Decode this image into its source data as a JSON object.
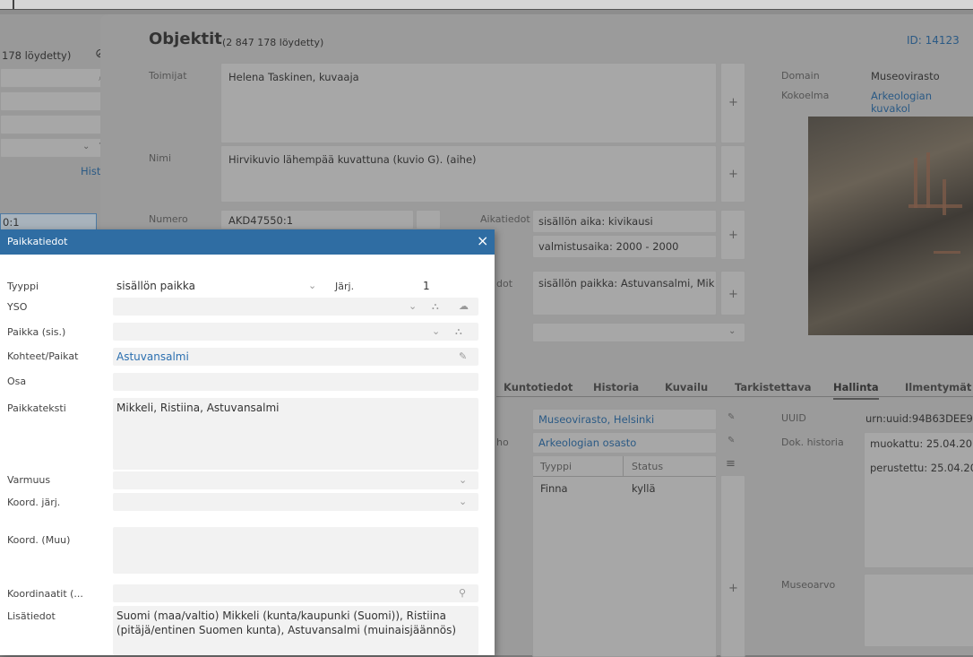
{
  "left_panel": {
    "count_text": "178 löydetty)",
    "history_link": "History",
    "selected_value": "0:1",
    "selected_sub": "Hirvikuvio lähempää"
  },
  "main": {
    "title": "Objektit",
    "count": "(2 847 178 löydetty)",
    "id_label": "ID: 14123",
    "fields": {
      "toimijat_label": "Toimijat",
      "toimijat_value": "Helena Taskinen, kuvaaja",
      "nimi_label": "Nimi",
      "nimi_value": "Hirvikuvio lähempää kuvattuna (kuvio G). (aihe)",
      "numero_label": "Numero",
      "numero_value": "AKD47550:1",
      "aikatiedot_label": "Aikatiedot",
      "aika_1": "sisällön aika: kivikausi",
      "aika_2": "valmistusaika: 2000 - 2000",
      "paikkatiedot_label_partial": "dot",
      "paikka_value": "sisällön paikka: Astuvansalmi, Mik"
    },
    "side": {
      "domain_label": "Domain",
      "domain_value": "Museovirasto",
      "kokoelma_label": "Kokoelma",
      "kokoelma_value": "Arkeologian kuvakol"
    },
    "tabs": [
      "Kuntotiedot",
      "Historia",
      "Kuvailu",
      "Tarkistettava",
      "Hallinta",
      "Ilmentymät"
    ],
    "hallinta": {
      "org_value": "Museovirasto, Helsinki",
      "unit_label_partial": "ho",
      "unit_value": "Arkeologian osasto",
      "table_headers": [
        "Tyyppi",
        "Status"
      ],
      "table_rows": [
        [
          "Finna",
          "kyllä"
        ]
      ],
      "uuid_label": "UUID",
      "uuid_value": "urn:uuid:94B63DEE9",
      "dok_label": "Dok. historia",
      "dok_1": "muokattu: 25.04.20",
      "dok_2": "perustettu: 25.04.20",
      "museoarvo_label": "Museoarvo"
    }
  },
  "dialog": {
    "title": "Paikkatiedot",
    "close": "×",
    "tyyppi_label": "Tyyppi",
    "tyyppi_value": "sisällön paikka",
    "jarj_label": "Järj.",
    "jarj_value": "1",
    "yso_label": "YSO",
    "paikka_sis_label": "Paikka (sis.)",
    "kohteet_label": "Kohteet/Paikat",
    "kohteet_value": "Astuvansalmi",
    "osa_label": "Osa",
    "paikkateksti_label": "Paikkateksti",
    "paikkateksti_value": "Mikkeli, Ristiina, Astuvansalmi",
    "varmuus_label": "Varmuus",
    "koord_jarj_label": "Koord. järj.",
    "koord_muu_label": "Koord. (Muu)",
    "koordinaatit_label": "Koordinaatit (...",
    "lisatiedot_label": "Lisätiedot",
    "lisatiedot_line1": "Suomi (maa/valtio) Mikkeli (kunta/kaupunki (Suomi)), Ristiina",
    "lisatiedot_line2": "(pitäjä/entinen Suomen kunta), Astuvansalmi (muinaisjäännös)"
  }
}
